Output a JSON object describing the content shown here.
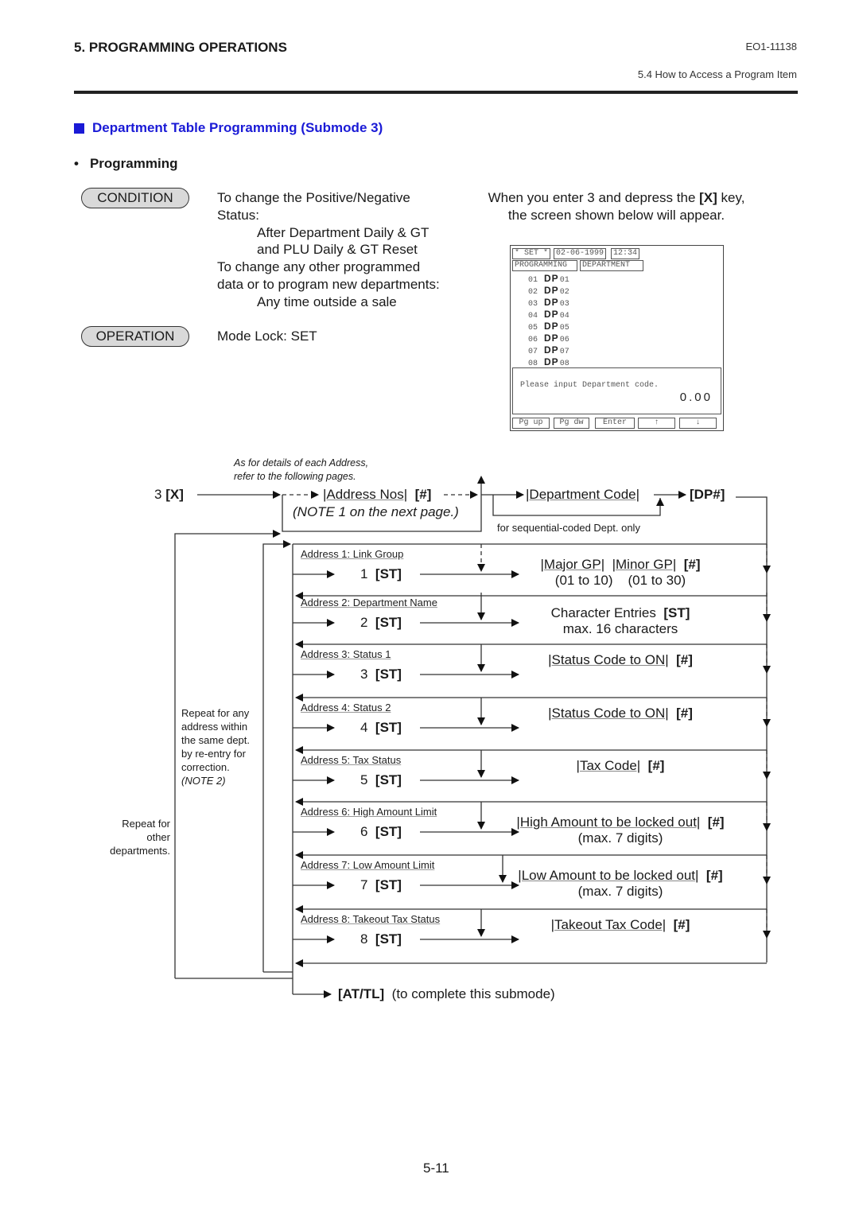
{
  "header": {
    "chapter": "5.  PROGRAMMING OPERATIONS",
    "doc_code": "EO1-11138",
    "section": "5.4  How to Access a Program Item"
  },
  "section_title": "Department Table Programming (Submode 3)",
  "subsection": {
    "bullet": "•",
    "title": "Programming"
  },
  "condition": {
    "label": "CONDITION",
    "lines": [
      "To change the Positive/Negative",
      "Status:",
      "After Department Daily & GT",
      "and PLU Daily & GT Reset",
      "To change any other programmed",
      "data or to program new departments:",
      "Any time outside a sale"
    ]
  },
  "operation": {
    "label": "OPERATION",
    "text": "Mode Lock:  SET"
  },
  "intro": {
    "line1_pre": "When you enter 3 and depress the ",
    "line1_key": "[X]",
    "line1_post": " key,",
    "line2": "the screen shown below will appear."
  },
  "screen": {
    "mode": "* SET *",
    "date": "02-06-1999",
    "time": "12:34",
    "title1": "PROGRAMMING",
    "title2": "DEPARTMENT",
    "rows": [
      {
        "no": "01",
        "dp": "DP",
        "code": "01"
      },
      {
        "no": "02",
        "dp": "DP",
        "code": "02"
      },
      {
        "no": "03",
        "dp": "DP",
        "code": "03"
      },
      {
        "no": "04",
        "dp": "DP",
        "code": "04"
      },
      {
        "no": "05",
        "dp": "DP",
        "code": "05"
      },
      {
        "no": "06",
        "dp": "DP",
        "code": "06"
      },
      {
        "no": "07",
        "dp": "DP",
        "code": "07"
      },
      {
        "no": "08",
        "dp": "DP",
        "code": "08"
      }
    ],
    "prompt": "Please input Department code.",
    "value": "0.00",
    "buttons": [
      "Pg up",
      "Pg dw",
      "Enter",
      "↑",
      "↓"
    ]
  },
  "flow": {
    "note_details": [
      "As for details of each Address,",
      "refer to the following pages."
    ],
    "start_key_num": "3 ",
    "start_key": "[X]",
    "address_nos": "|Address Nos|",
    "hash": "[#]",
    "note1": "(NOTE 1 on the next page.)",
    "dept_code": "|Department Code|",
    "dp_key": "[DP#]",
    "seq_note": "for sequential-coded Dept. only",
    "repeat_address": [
      "Repeat for any",
      "address within",
      "the same dept.",
      "by re-entry for",
      "correction."
    ],
    "note2": "(NOTE 2)",
    "repeat_dept": [
      "Repeat for",
      "other",
      "departments."
    ],
    "addresses": [
      {
        "label": "Address 1:  Link Group",
        "num": "1",
        "key": "[ST]",
        "entry": [
          "|Major GP|",
          "|Minor GP|"
        ],
        "entry_key": "[#]",
        "sub": [
          "(01 to 10)",
          "(01 to 30)"
        ]
      },
      {
        "label": "Address 2:  Department Name",
        "num": "2",
        "key": "[ST]",
        "entry_plain": "Character Entries",
        "entry_key": "[ST]",
        "sub_text": "max. 16 characters"
      },
      {
        "label": "Address 3:  Status 1",
        "num": "3",
        "key": "[ST]",
        "entry_u": "|Status Code to ON|",
        "entry_key": "[#]"
      },
      {
        "label": "Address 4:  Status 2",
        "num": "4",
        "key": "[ST]",
        "entry_u": "|Status Code to ON|",
        "entry_key": "[#]"
      },
      {
        "label": "Address 5:  Tax Status",
        "num": "5",
        "key": "[ST]",
        "entry_u": "|Tax Code|",
        "entry_key": "[#]"
      },
      {
        "label": "Address 6:  High Amount Limit",
        "num": "6",
        "key": "[ST]",
        "entry_u": "|High Amount to be locked out|",
        "entry_key": "[#]",
        "sub_text": "(max. 7 digits)"
      },
      {
        "label": "Address 7:  Low Amount Limit",
        "num": "7",
        "key": "[ST]",
        "entry_u": "|Low Amount to be locked out|",
        "entry_key": "[#]",
        "sub_text": "(max. 7 digits)"
      },
      {
        "label": "Address 8:  Takeout Tax Status",
        "num": "8",
        "key": "[ST]",
        "entry_u": "|Takeout Tax Code|",
        "entry_key": "[#]"
      }
    ],
    "end_key": "[AT/TL]",
    "end_text": "(to complete this submode)"
  },
  "page_number": "5-11",
  "colors": {
    "heading_blue": "#1a1ad6",
    "pill_gray": "#d9d9d9"
  }
}
